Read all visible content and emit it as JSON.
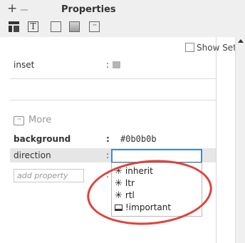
{
  "panel": {
    "title": "Properties",
    "show_set_label": "Show Set"
  },
  "toolbar": {
    "icons": [
      "layout-icon",
      "text-icon",
      "border-icon",
      "background-icon",
      "more-icon"
    ],
    "text_icon_glyph": "T",
    "more_icon_glyph": "···"
  },
  "properties": {
    "inset": {
      "label": "inset",
      "colon": ":"
    },
    "more_label": "More",
    "background": {
      "label": "background",
      "colon": ":",
      "value": "#0b0b0b"
    },
    "direction": {
      "label": "direction",
      "colon": ":",
      "value": ""
    },
    "add_property": {
      "placeholder": "add property",
      "colon": ":"
    }
  },
  "dropdown": {
    "options": [
      {
        "label": "inherit",
        "icon": "asterisk-icon"
      },
      {
        "label": "ltr",
        "icon": "asterisk-icon"
      },
      {
        "label": "rtl",
        "icon": "asterisk-icon"
      },
      {
        "label": "!important",
        "icon": "important-box-icon"
      }
    ]
  },
  "colors": {
    "highlight_ring": "#e0413a",
    "focus_border": "#4a88c0"
  },
  "glyphs": {
    "plus": "+",
    "asterisk": "✳"
  }
}
